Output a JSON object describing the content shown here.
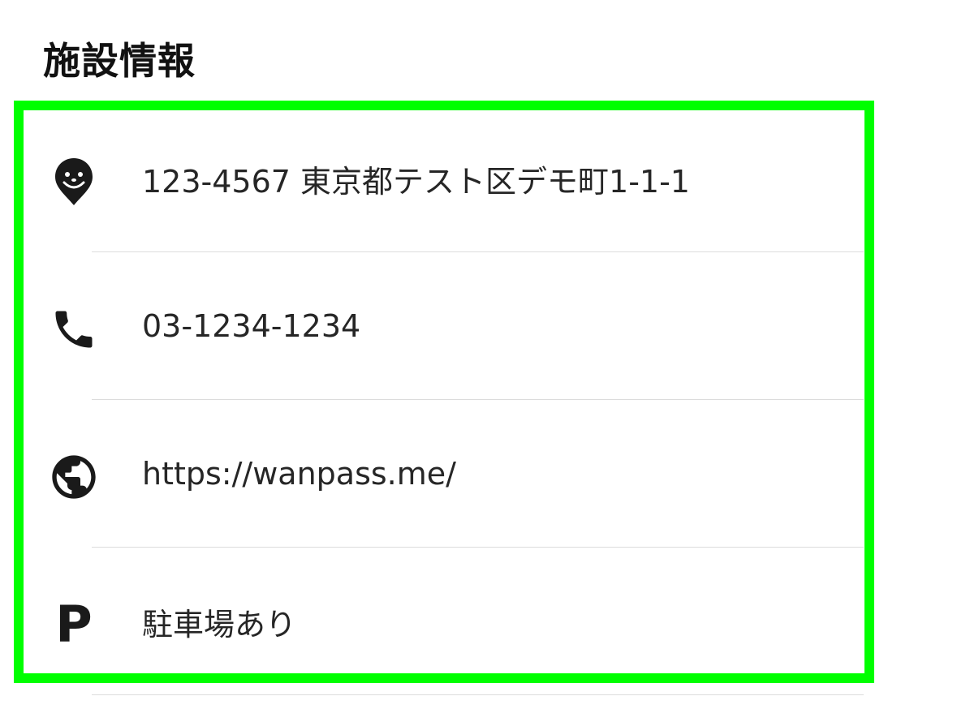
{
  "section": {
    "title": "施設情報"
  },
  "facility_info": [
    {
      "icon": "map-pin-dog-icon",
      "text": "123-4567 東京都テスト区デモ町1-1-1"
    },
    {
      "icon": "phone-icon",
      "text": "03-1234-1234"
    },
    {
      "icon": "globe-icon",
      "text": "https://wanpass.me/"
    },
    {
      "icon": "parking-icon",
      "icon_glyph": "P",
      "text": "駐車場あり"
    }
  ],
  "colors": {
    "highlight_border": "#00ff00",
    "text": "#262626",
    "divider": "#dcdcdc",
    "icon": "#1a1a1a"
  }
}
